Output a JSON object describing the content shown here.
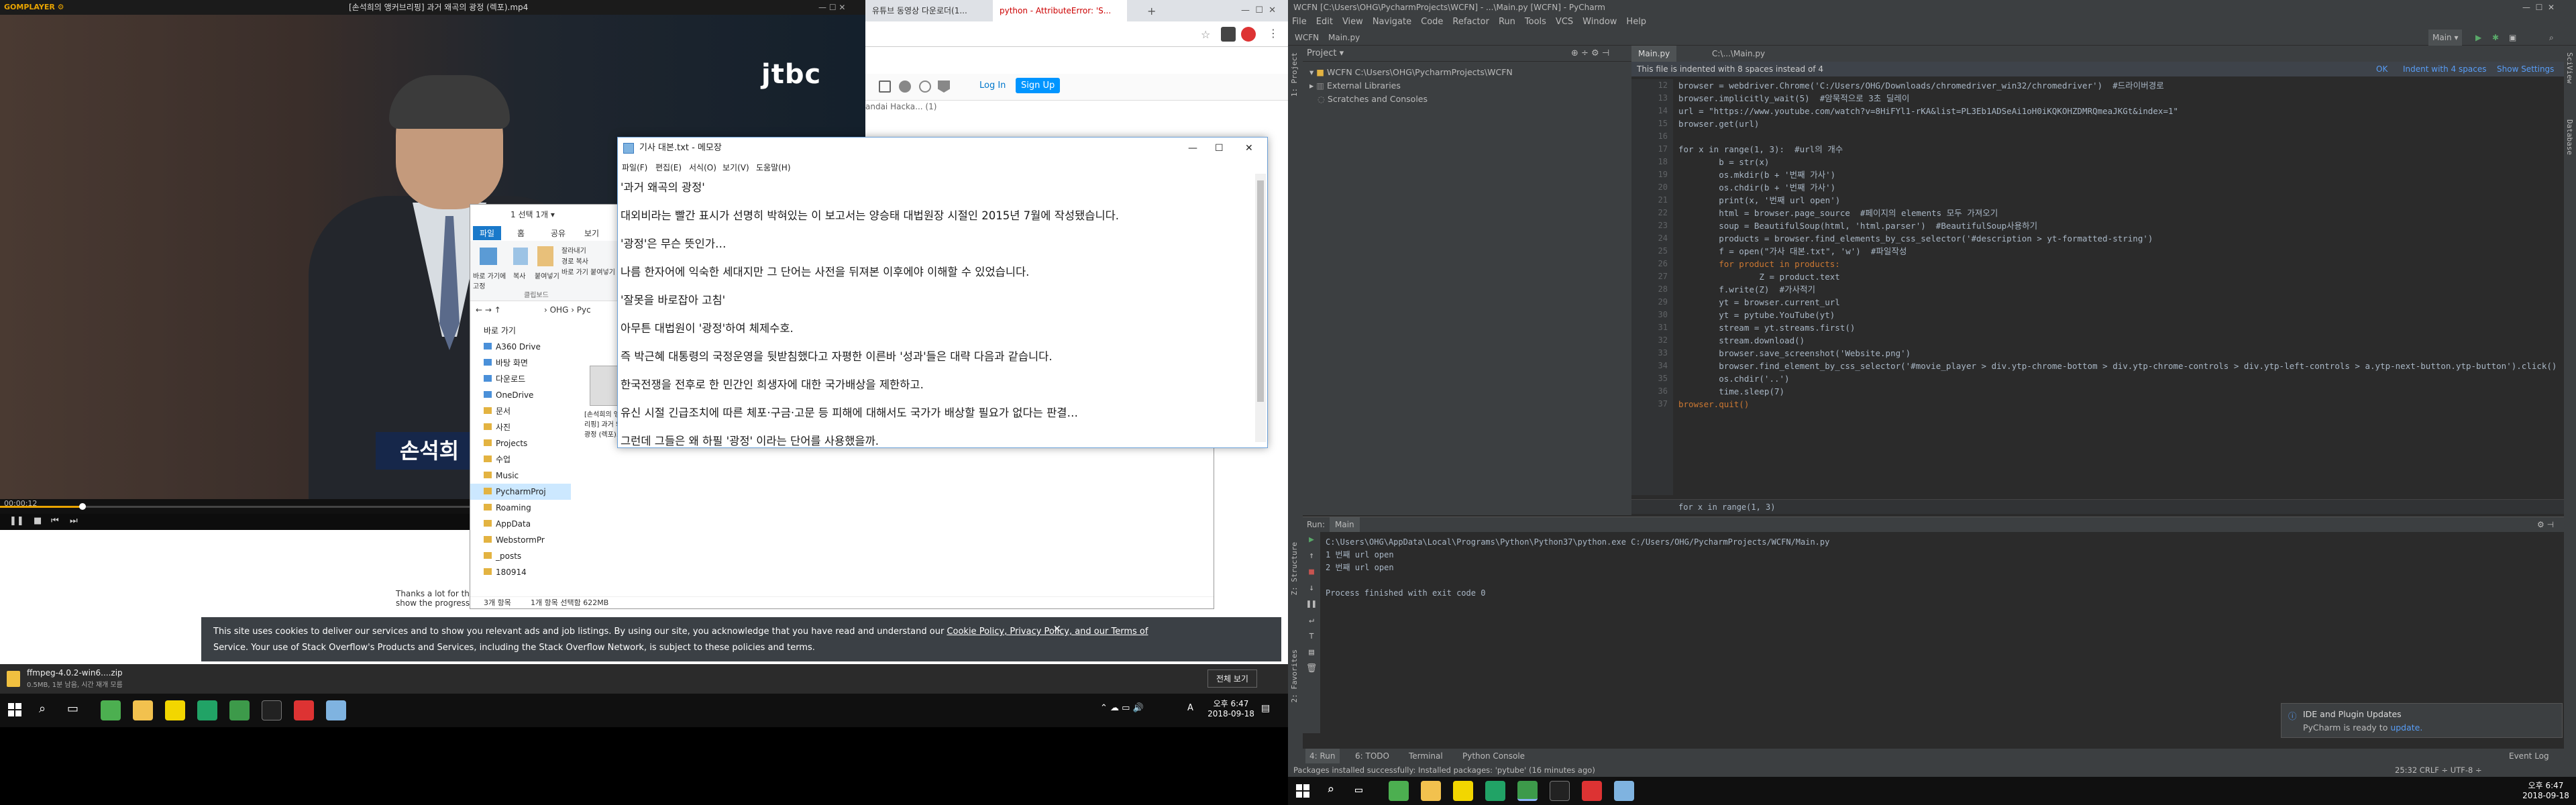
{
  "gom": {
    "title_left": "GOMPLAYER ⚙",
    "title": "[손석희의 앵커브리핑] 과거 왜곡의 광정 (렉포).mp4",
    "watermark": "jtbc",
    "caption": "손석희",
    "time": "00:00:12"
  },
  "browser": {
    "tab1": "유튜브 동영상 다운로더(1...",
    "tab2": "python - AttributeError: 'S...",
    "login": "Log In",
    "signup": "Sign Up",
    "fragment": "andai Hacka... (1)",
    "thanks": "Thanks a lot for the",
    "show": "show the progress"
  },
  "notepad": {
    "title": "기사 대본.txt - 메모장",
    "menu": [
      "파일(F)",
      "편집(E)",
      "서식(O)",
      "보기(V)",
      "도움말(H)"
    ],
    "lines": [
      "'과거 왜곡의 광정'",
      "대외비라는 빨간 표시가 선명히 박혀있는 이 보고서는 양승태 대법원장 시절인 2015년 7월에 작성됐습니다.",
      "'광정'은 무슨 뜻인가…",
      "나름 한자어에 익숙한 세대지만 그 단어는 사전을 뒤져본 이후에야 이해할 수 있었습니다.",
      "'잘못을 바로잡아 고침'",
      "아무튼 대법원이 '광정'하여 체제수호.",
      "즉 박근혜 대통령의 국정운영을 뒷받침했다고 자평한 이른바 '성과'들은 대략 다음과 같습니다.",
      "한국전쟁을 전후로 한 민간인 희생자에 대한 국가배상을 제한하고.",
      "유신 시절 긴급조치에 따른 체포·구금·고문 등 피해에 대해서도 국가가 배상할 필요가 없다는 판결…",
      "그런데 그들은 왜 하필 '광정' 이라는 단어를 사용했을까."
    ]
  },
  "explorer": {
    "title": "1 선택 1개 ▾",
    "ribbon": [
      "파일",
      "홈",
      "공유",
      "보기"
    ],
    "ribbon_labels": [
      "바로 가기에 고정",
      "복사",
      "붙여넣기",
      "잘라내기",
      "경로 복사",
      "바로 가기 붙여넣기",
      "클립보드"
    ],
    "path": "› OHG › Pyc",
    "quick_access": "바로 가기",
    "nav": [
      "A360 Drive",
      "바탕 화면",
      "다운로드",
      "OneDrive",
      "문서",
      "사진",
      "Projects",
      "수업",
      "Music",
      "PycharmProj",
      "Roaming",
      "AppData",
      "WebstormPr",
      "_posts",
      "180914"
    ],
    "file_label": "[손석희의 앵커브리핑] 과거 왜곡의 광정 (렉포).mp4",
    "status_left": "3개 항목",
    "status_mid": "1개 항목 선택함 622MB"
  },
  "cookie": {
    "text1": "This site uses cookies to deliver our services and to show you relevant ads and job listings. By using our site, you acknowledge that you have read and understand our",
    "text2": "Cookie Policy, Privacy Policy, and our Terms of",
    "text3": "Service. Your use of Stack Overflow's Products and Services, including the Stack Overflow Network, is subject to these policies and terms."
  },
  "download": {
    "file": "ffmpeg-4.0.2-win6....zip",
    "sub": "0.5MB, 1분 남음, 시간 재개 모름",
    "show_all": "전체 보기"
  },
  "left_tray": {
    "time": "오후 6:47",
    "date": "2018-09-18",
    "lang": "A"
  },
  "pycharm": {
    "title": "WCFN [C:\\Users\\OHG\\PycharmProjects\\WCFN] - ...\\Main.py [WCFN] - PyCharm",
    "menu": [
      "File",
      "Edit",
      "View",
      "Navigate",
      "Code",
      "Refactor",
      "Run",
      "Tools",
      "VCS",
      "Window",
      "Help"
    ],
    "nav_project": "WCFN",
    "nav_file": "Main.py",
    "run_config": "Main ▾",
    "project_header": "Project ▾",
    "tree": [
      "WCFN  C:\\Users\\OHG\\PycharmProjects\\WCFN",
      "External Libraries",
      "Scratches and Consoles"
    ],
    "editor_tab1": "Main.py",
    "editor_tab2": "C:\\...\\Main.py",
    "banner": "This file is indented with 8 spaces instead of 4",
    "banner_ok": "OK",
    "banner_indent": "Indent with 4 spaces",
    "banner_show": "Show Settings",
    "code": [
      "browser = webdriver.Chrome('C:/Users/OHG/Downloads/chromedriver_win32/chromedriver')  #드라이버경로",
      "browser.implicitly_wait(5)  #암묵적으로 3초 딜레이",
      "url = \"https://www.youtube.com/watch?v=8HiFYl1-rKA&list=PL3Eb1ADSeAi1oH0iKQKOHZDMRQmeaJKGt&index=1\"",
      "browser.get(url)",
      "",
      "for x in range(1, 3):  #url의 개수",
      "        b = str(x)",
      "        os.mkdir(b + '번째 가사')",
      "        os.chdir(b + '번째 가사')",
      "        print(x, '번째 url open')",
      "        html = browser.page_source  #페이지의 elements 모두 가져오기",
      "        soup = BeautifulSoup(html, 'html.parser')  #BeautifulSoup사용하기",
      "        products = browser.find_elements_by_css_selector('#description > yt-formatted-string')",
      "        f = open(\"가사 대본.txt\", 'w')  #파일작성",
      "        for product in products:",
      "                Z = product.text",
      "        f.write(Z)  #가사적기",
      "        yt = browser.current_url",
      "        yt = pytube.YouTube(yt)",
      "        stream = yt.streams.first()",
      "        stream.download()",
      "        browser.save_screenshot('Website.png')",
      "        browser.find_element_by_css_selector('#movie_player > div.ytp-chrome-bottom > div.ytp-chrome-controls > div.ytp-left-controls > a.ytp-next-button.ytp-button').click()",
      "        os.chdir('..')",
      "        time.sleep(7)",
      "browser.quit()"
    ],
    "breadcrumb": "for x in range(1, 3)",
    "run_label": "Run:",
    "run_tab": "Main",
    "console": [
      "C:\\Users\\OHG\\AppData\\Local\\Programs\\Python\\Python37\\python.exe C:/Users/OHG/PycharmProjects/WCFN/Main.py",
      "1 번째 url open",
      "2 번째 url open",
      "",
      "Process finished with exit code 0"
    ],
    "bottom_tabs": [
      "4: Run",
      "6: TODO",
      "Terminal",
      "Python Console"
    ],
    "event_log": "Event Log",
    "status": "Packages installed successfully: Installed packages: 'pytube' (16 minutes ago)",
    "status_right": "25:32   CRLF ÷   UTF-8 ÷",
    "notif_title": "IDE and Plugin Updates",
    "notif_body": "PyCharm is ready to",
    "notif_link": "update.",
    "time": "오후 6:47",
    "date": "2018-09-18"
  }
}
